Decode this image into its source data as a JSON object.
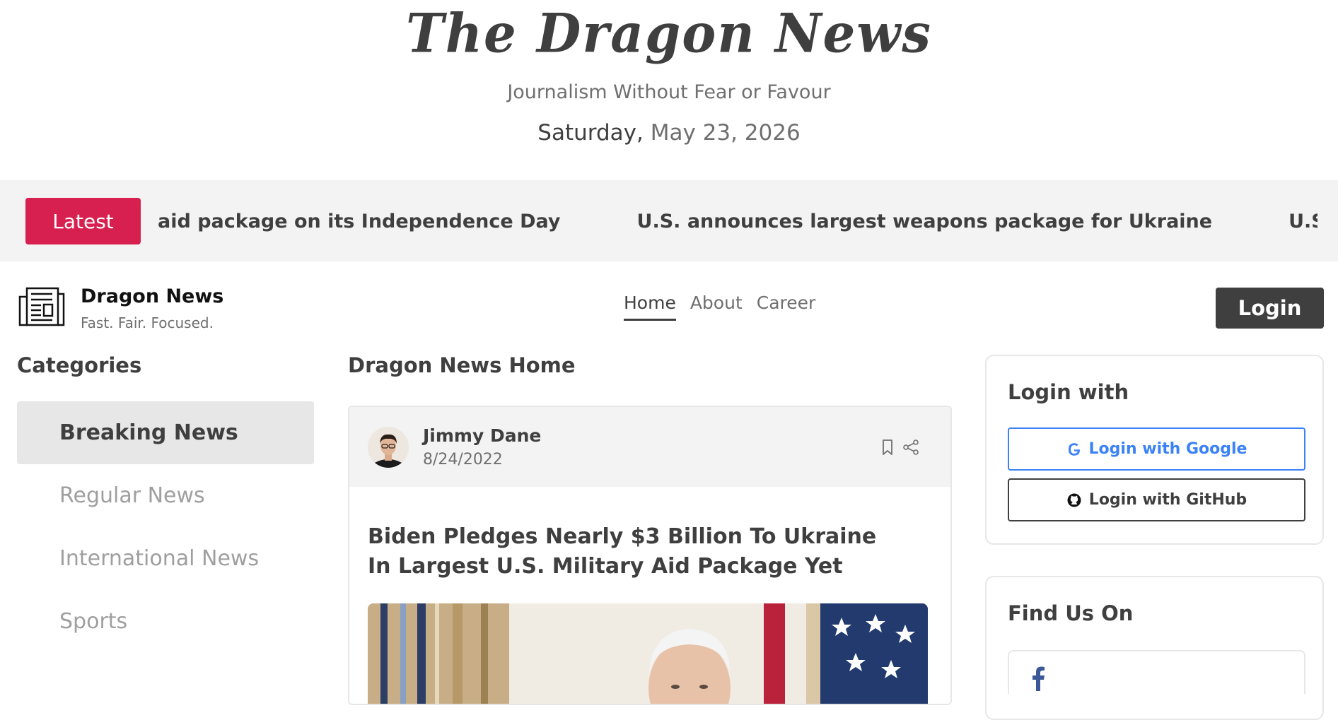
{
  "masthead": {
    "title": "The Dragon News",
    "tagline": "Journalism Without Fear or Favour",
    "day": "Saturday,",
    "date": "May 23, 2026"
  },
  "ticker": {
    "label": "Latest",
    "items": [
      "aid package on its Independence Day",
      "U.S. announces largest weapons package for Ukraine",
      "U.S. concerns"
    ]
  },
  "navbar": {
    "brand": "Dragon News",
    "brand_tagline": "Fast. Fair. Focused.",
    "links": [
      "Home",
      "About",
      "Career"
    ],
    "active_link": "Home",
    "login": "Login"
  },
  "categories": {
    "title": "Categories",
    "items": [
      "Breaking News",
      "Regular News",
      "International News",
      "Sports"
    ],
    "active": "Breaking News"
  },
  "main": {
    "title": "Dragon News Home",
    "article": {
      "author": "Jimmy Dane",
      "date": "8/24/2022",
      "headline": "Biden Pledges Nearly $3 Billion To Ukraine In Largest U.S. Military Aid Package Yet",
      "icons": [
        "bookmark-icon",
        "share-icon"
      ]
    }
  },
  "sidebar": {
    "login_title": "Login with",
    "google_label": "Login with Google",
    "github_label": "Login with GitHub",
    "find_title": "Find Us On"
  },
  "colors": {
    "accent": "#d72050",
    "dark": "#403f3f",
    "muted": "#706f6f",
    "google_blue": "#3b82f6",
    "ticker_bg": "#f3f3f3"
  }
}
